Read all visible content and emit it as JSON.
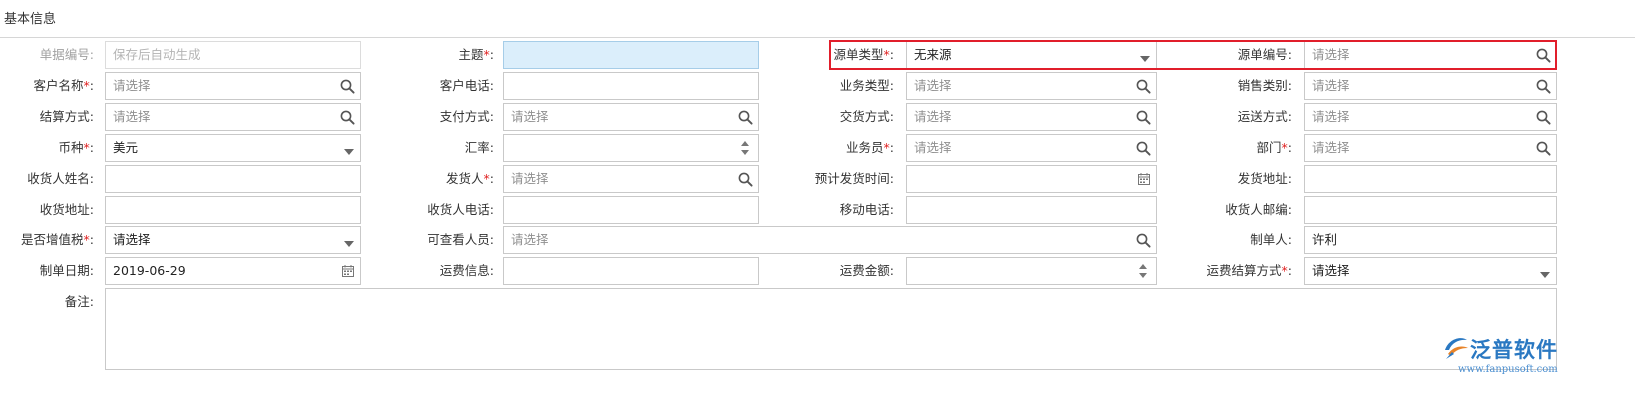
{
  "section": {
    "title": "基本信息"
  },
  "rows": [
    {
      "fields": [
        {
          "label": "单据编号:",
          "required": false,
          "disabled": true,
          "value": "保存后自动生成",
          "placeholder": true,
          "icon": "none",
          "style": "disabled"
        },
        {
          "label": "主题",
          "required": true,
          "value": "",
          "icon": "none",
          "style": "highlight"
        },
        {
          "label": "源单类型",
          "required": true,
          "value": "无来源",
          "icon": "caret-down-icon"
        },
        {
          "label": "源单编号:",
          "required": false,
          "value": "请选择",
          "placeholder": true,
          "icon": "search-icon"
        }
      ]
    },
    {
      "fields": [
        {
          "label": "客户名称",
          "required": true,
          "value": "请选择",
          "placeholder": true,
          "icon": "search-icon"
        },
        {
          "label": "客户电话:",
          "required": false,
          "value": "",
          "icon": "none"
        },
        {
          "label": "业务类型:",
          "required": false,
          "value": "请选择",
          "placeholder": true,
          "icon": "search-icon"
        },
        {
          "label": "销售类别:",
          "required": false,
          "value": "请选择",
          "placeholder": true,
          "icon": "search-icon"
        }
      ]
    },
    {
      "fields": [
        {
          "label": "结算方式:",
          "required": false,
          "value": "请选择",
          "placeholder": true,
          "icon": "search-icon"
        },
        {
          "label": "支付方式:",
          "required": false,
          "value": "请选择",
          "placeholder": true,
          "icon": "search-icon"
        },
        {
          "label": "交货方式:",
          "required": false,
          "value": "请选择",
          "placeholder": true,
          "icon": "search-icon"
        },
        {
          "label": "运送方式:",
          "required": false,
          "value": "请选择",
          "placeholder": true,
          "icon": "search-icon"
        }
      ]
    },
    {
      "fields": [
        {
          "label": "币种",
          "required": true,
          "value": "美元",
          "icon": "caret-down-icon"
        },
        {
          "label": "汇率:",
          "required": false,
          "value": "",
          "icon": "spinner-icon"
        },
        {
          "label": "业务员",
          "required": true,
          "value": "请选择",
          "placeholder": true,
          "icon": "search-icon"
        },
        {
          "label": "部门",
          "required": true,
          "value": "请选择",
          "placeholder": true,
          "icon": "search-icon"
        }
      ]
    },
    {
      "fields": [
        {
          "label": "收货人姓名:",
          "required": false,
          "value": "",
          "icon": "none"
        },
        {
          "label": "发货人",
          "required": true,
          "value": "请选择",
          "placeholder": true,
          "icon": "search-icon"
        },
        {
          "label": "预计发货时间:",
          "required": false,
          "value": "",
          "icon": "calendar-icon"
        },
        {
          "label": "发货地址:",
          "required": false,
          "value": "",
          "icon": "none"
        }
      ]
    },
    {
      "fields": [
        {
          "label": "收货地址:",
          "required": false,
          "value": "",
          "icon": "none"
        },
        {
          "label": "收货人电话:",
          "required": false,
          "value": "",
          "icon": "none"
        },
        {
          "label": "移动电话:",
          "required": false,
          "value": "",
          "icon": "none"
        },
        {
          "label": "收货人邮编:",
          "required": false,
          "value": "",
          "icon": "none"
        }
      ]
    },
    {
      "fields": [
        {
          "label": "是否增值税",
          "required": true,
          "value": "请选择",
          "placeholder": false,
          "icon": "caret-down-icon"
        },
        {
          "label": "可查看人员:",
          "required": false,
          "value": "请选择",
          "placeholder": true,
          "icon": "search-icon",
          "wide": true
        },
        {
          "label": "制单人:",
          "required": false,
          "value": "许利",
          "icon": "none"
        }
      ]
    },
    {
      "fields": [
        {
          "label": "制单日期:",
          "required": false,
          "value": "2019-06-29",
          "icon": "calendar-icon"
        },
        {
          "label": "运费信息:",
          "required": false,
          "value": "",
          "icon": "none"
        },
        {
          "label": "运费金额:",
          "required": false,
          "value": "",
          "icon": "spinner-icon"
        },
        {
          "label": "运费结算方式",
          "required": true,
          "value": "请选择",
          "placeholder": false,
          "icon": "caret-down-icon"
        }
      ]
    }
  ],
  "remarks": {
    "label": "备注:",
    "value": ""
  },
  "logo": {
    "brand": "泛普软件",
    "url": "www.fanpusoft.com"
  },
  "colors": {
    "required": "#e02020",
    "highlight_border": "#e11e2b",
    "input_highlight": "#dbeefb",
    "brand": "#2a78c2"
  }
}
